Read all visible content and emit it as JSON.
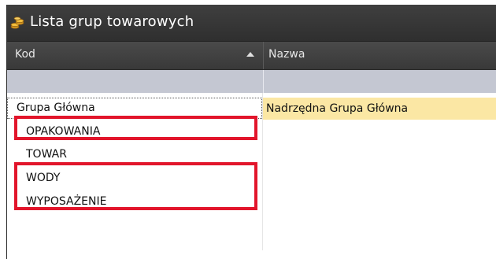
{
  "window": {
    "title": "Lista grup towarowych",
    "icon": "coins-icon"
  },
  "grid": {
    "columns": [
      {
        "label": "Kod",
        "sort": "ascending"
      },
      {
        "label": "Nazwa"
      }
    ],
    "group_row": {
      "kod": "Grupa Główna",
      "nazwa": "Nadrzędna Grupa Główna"
    },
    "rows": [
      {
        "kod": "OPAKOWANIA",
        "nazwa": ""
      },
      {
        "kod": "TOWAR",
        "nazwa": ""
      },
      {
        "kod": "WODY",
        "nazwa": ""
      },
      {
        "kod": "WYPOSAŻENIE",
        "nazwa": ""
      }
    ]
  },
  "colors": {
    "highlight": "#e2152b",
    "selected_cell": "#fbe7a4",
    "header": "#3a3a3a",
    "filter_row": "#c4c7d2"
  }
}
